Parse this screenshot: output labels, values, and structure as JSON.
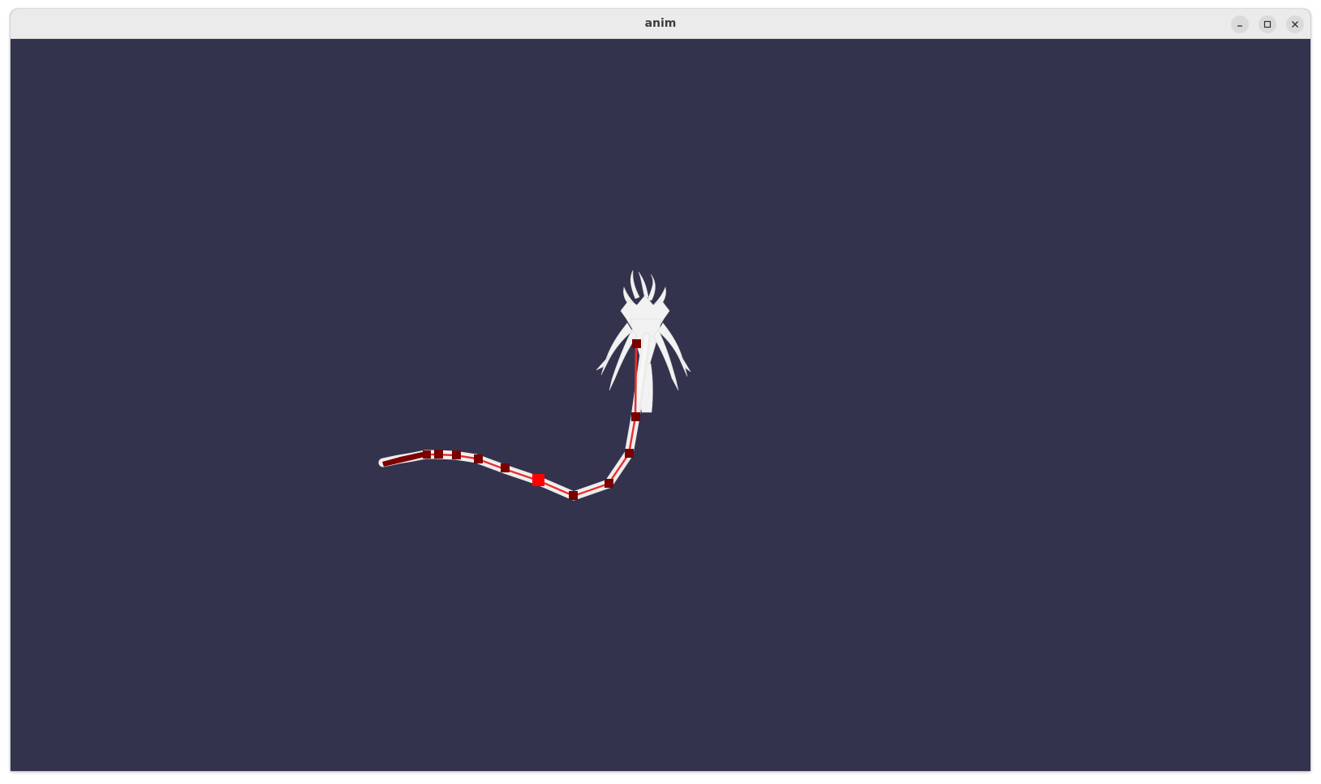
{
  "window": {
    "title": "anim",
    "controls": [
      {
        "name": "minimize",
        "icon": "minimize-icon"
      },
      {
        "name": "maximize",
        "icon": "maximize-icon"
      },
      {
        "name": "close",
        "icon": "close-icon"
      }
    ]
  },
  "scene": {
    "background": "#34334e",
    "creature_color": "#f2f2f2",
    "bone_color": "#e83030",
    "joint_color": "#7a0000",
    "selected_joint_color": "#ff0000"
  }
}
